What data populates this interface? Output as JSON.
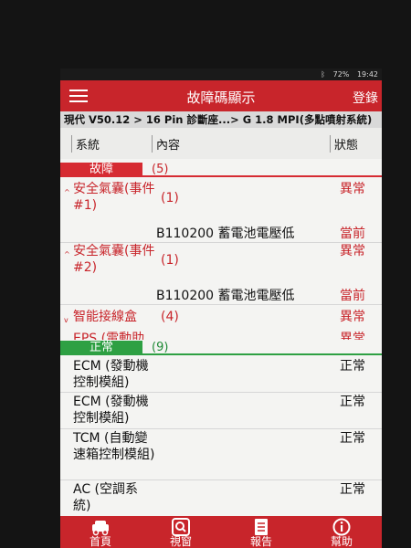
{
  "statusbar": {
    "bluetooth": "ᛒ",
    "battery": "72%",
    "time": "19:42"
  },
  "appbar": {
    "title": "故障碼顯示",
    "login_label": "登錄"
  },
  "breadcrumb": "現代 V50.12 > 16 Pin 診斷座...> G 1.8 MPI(多點噴射系統)",
  "columns": {
    "system": "系統",
    "content": "內容",
    "status": "狀態"
  },
  "fault_group": {
    "label": "故障",
    "count": "(5)"
  },
  "ok_group": {
    "label": "正常",
    "count": "(9)"
  },
  "fault_rows": [
    {
      "system": "安全氣囊(事件 #1)",
      "count": "(1)",
      "status": "異常",
      "code": "B110200 蓄電池電壓低",
      "code_status": "當前"
    },
    {
      "system": "安全氣囊(事件 #2)",
      "count": "(1)",
      "status": "異常",
      "code": "B110200 蓄電池電壓低",
      "code_status": "當前"
    },
    {
      "system": "智能接線盒",
      "count": "(4)",
      "status": "異常"
    },
    {
      "system": "EPS (電動助",
      "status": "異常"
    }
  ],
  "ok_rows": [
    {
      "system": "ECM (發動機控制模組)",
      "status": "正常"
    },
    {
      "system": "ECM (發動機控制模組)",
      "status": "正常"
    },
    {
      "system": "TCM (自動變速箱控制模組)",
      "status": "正常"
    },
    {
      "system": "AC (空調系統)",
      "status": "正常"
    }
  ],
  "bottom_nav": [
    {
      "label": "首頁",
      "icon": "car-icon"
    },
    {
      "label": "視窗",
      "icon": "search-icon"
    },
    {
      "label": "報告",
      "icon": "report-icon"
    },
    {
      "label": "幫助",
      "icon": "info-icon"
    }
  ],
  "colors": {
    "accent": "#c8252b",
    "ok": "#2ea043"
  }
}
